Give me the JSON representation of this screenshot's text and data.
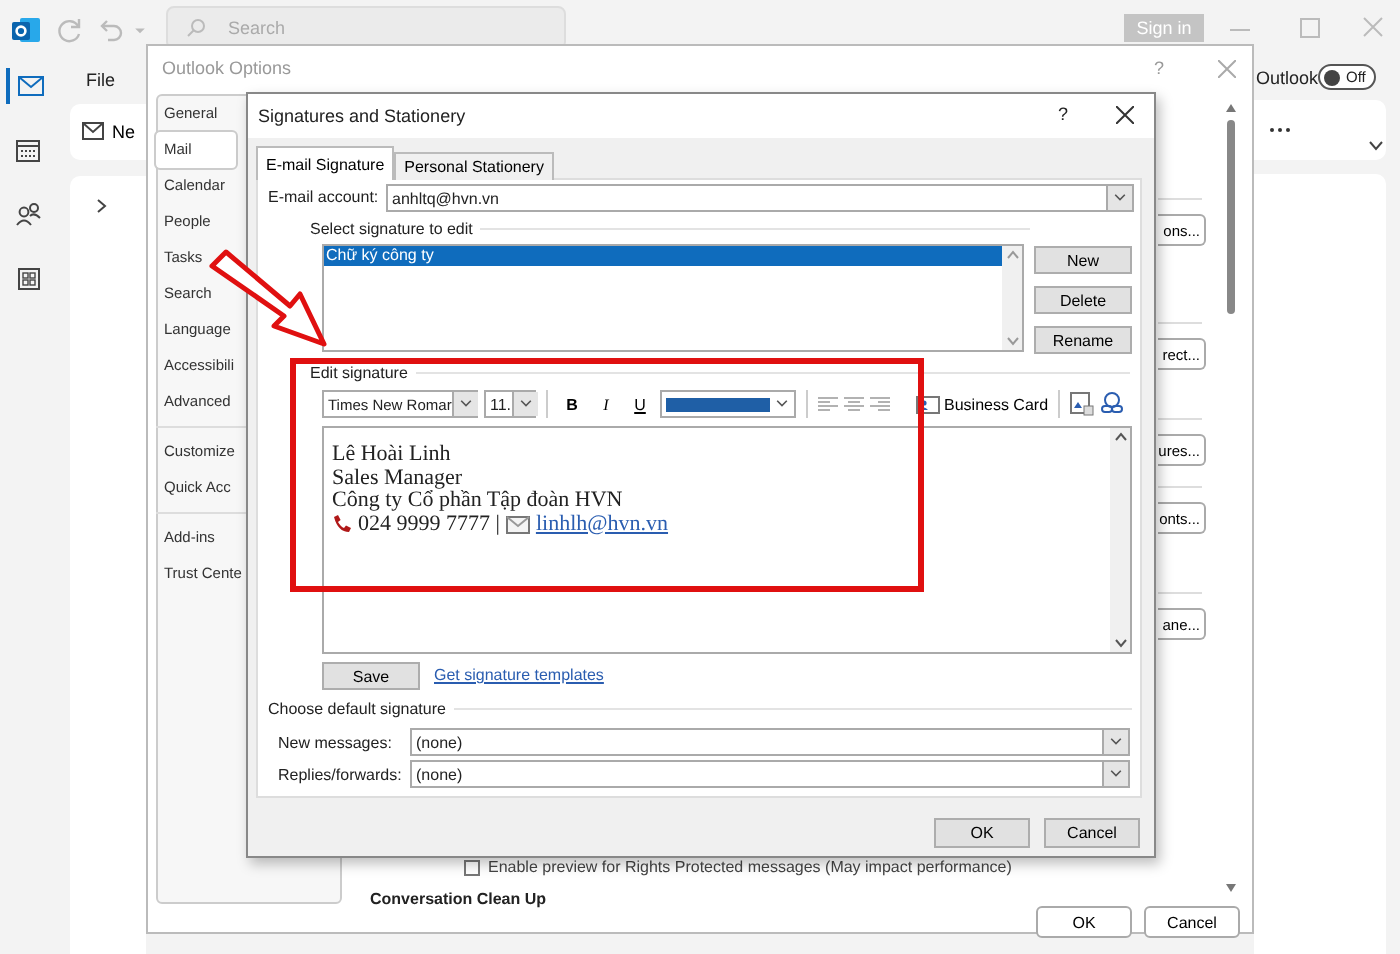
{
  "app": {
    "search": {
      "placeholder": "Search"
    },
    "sign_in": "Sign in",
    "file_menu": "File",
    "new_button": "Ne",
    "nav": [
      {
        "kind": "mail",
        "selected": true
      },
      {
        "kind": "calendar",
        "selected": false
      },
      {
        "kind": "people",
        "selected": false
      },
      {
        "kind": "apps",
        "selected": false
      }
    ],
    "toggle": {
      "label": "Outlook",
      "state_text": "Off",
      "on": false
    }
  },
  "options_window": {
    "title": "Outlook Options",
    "help": "?",
    "categories": [
      {
        "label": "General",
        "selected": false
      },
      {
        "label": "Mail",
        "selected": true
      },
      {
        "label": "Calendar",
        "selected": false
      },
      {
        "label": "People",
        "selected": false
      },
      {
        "label": "Tasks",
        "selected": false
      },
      {
        "label": "Search",
        "selected": false
      },
      {
        "label": "Language",
        "selected": false
      },
      {
        "label": "Accessibili",
        "selected": false
      },
      {
        "label": "Advanced",
        "selected": false
      },
      {
        "label": "Customize",
        "selected": false
      },
      {
        "label": "Quick Acc",
        "selected": false
      },
      {
        "label": "Add-ins",
        "selected": false
      },
      {
        "label": "Trust Cente",
        "selected": false
      }
    ],
    "side_buttons": [
      "ons...",
      "rect...",
      "ures...",
      "onts...",
      "ane..."
    ],
    "preview_option": {
      "label": "Enable preview for Rights Protected messages (May impact performance)",
      "checked": false
    },
    "section_heading": "Conversation Clean Up",
    "buttons": [
      "OK",
      "Cancel"
    ]
  },
  "signature_dialog": {
    "title": "Signatures and Stationery",
    "help": "?",
    "tabs": [
      {
        "label": "E-mail Signature",
        "selected": true
      },
      {
        "label": "Personal Stationery",
        "selected": false
      }
    ],
    "account_label": "E-mail account:",
    "account": "anhltq@hvn.vn",
    "select_label": "Select signature to edit",
    "signatures": [
      {
        "name": "Chữ ký công ty",
        "selected": true
      }
    ],
    "list_buttons": [
      "New",
      "Delete",
      "Rename"
    ],
    "edit_label": "Edit signature",
    "toolbar": {
      "font": "Times New Romar",
      "size": "11.",
      "bold": "B",
      "italic": "I",
      "underline": "U",
      "business_card": "Business Card"
    },
    "signature_lines": [
      {
        "kind": "text",
        "text": "Lê Hoài Linh"
      },
      {
        "kind": "text",
        "text": "Sales Manager"
      },
      {
        "kind": "text",
        "text": "Công ty Cổ phần Tập đoàn HVN"
      },
      {
        "kind": "contact",
        "phone": "024 9999 7777 |",
        "email": "linhlh@hvn.vn"
      }
    ],
    "save": "Save",
    "templates_link": "Get signature templates",
    "default_label": "Choose default signature",
    "defaults": [
      {
        "label": "New messages:",
        "value": "(none)"
      },
      {
        "label": "Replies/forwards:",
        "value": "(none)"
      }
    ],
    "buttons": [
      "OK",
      "Cancel"
    ]
  }
}
